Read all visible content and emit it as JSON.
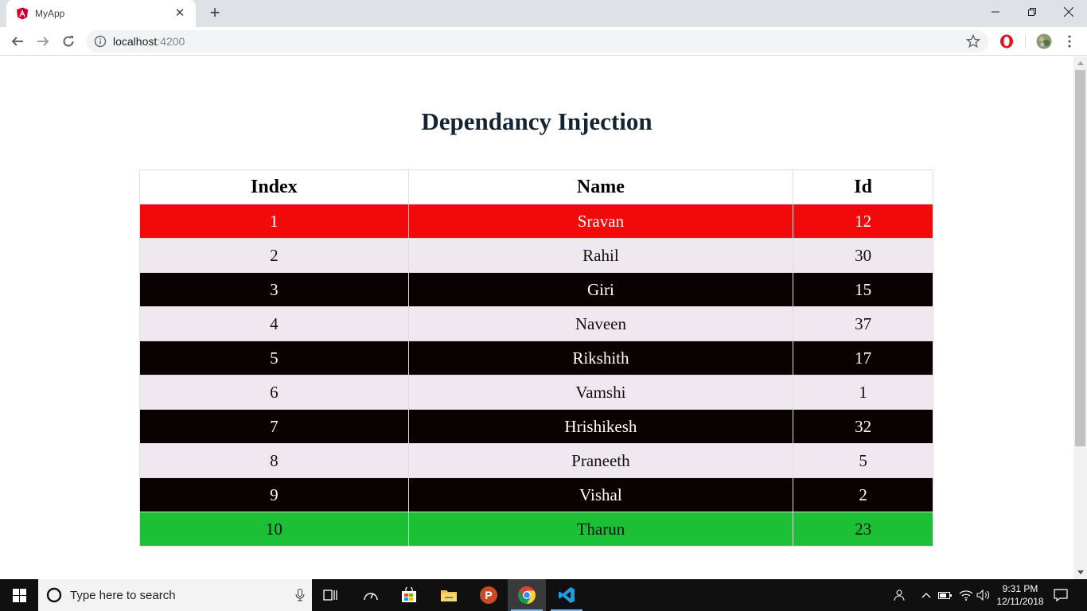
{
  "browser": {
    "tab": {
      "title": "MyApp"
    },
    "url": {
      "host": "localhost",
      "port": ":4200"
    }
  },
  "page": {
    "heading": "Dependancy Injection",
    "table": {
      "headers": [
        "Index",
        "Name",
        "Id"
      ],
      "rows": [
        {
          "index": "1",
          "name": "Sravan",
          "id": "12"
        },
        {
          "index": "2",
          "name": "Rahil",
          "id": "30"
        },
        {
          "index": "3",
          "name": "Giri",
          "id": "15"
        },
        {
          "index": "4",
          "name": "Naveen",
          "id": "37"
        },
        {
          "index": "5",
          "name": "Rikshith",
          "id": "17"
        },
        {
          "index": "6",
          "name": "Vamshi",
          "id": "1"
        },
        {
          "index": "7",
          "name": "Hrishikesh",
          "id": "32"
        },
        {
          "index": "8",
          "name": "Praneeth",
          "id": "5"
        },
        {
          "index": "9",
          "name": "Vishal",
          "id": "2"
        },
        {
          "index": "10",
          "name": "Tharun",
          "id": "23"
        }
      ]
    },
    "colors": {
      "first_row": "#f20a0a",
      "even_row": "#efe9ef",
      "odd_row": "#0a0202",
      "last_row": "#1cc034"
    }
  },
  "taskbar": {
    "search_placeholder": "Type here to search",
    "apps": [
      "task-view-icon",
      "speedometer-icon",
      "store-icon",
      "file-explorer-icon",
      "postman-icon",
      "chrome-icon",
      "vscode-icon"
    ],
    "time": "9:31 PM",
    "date": "12/11/2018"
  }
}
